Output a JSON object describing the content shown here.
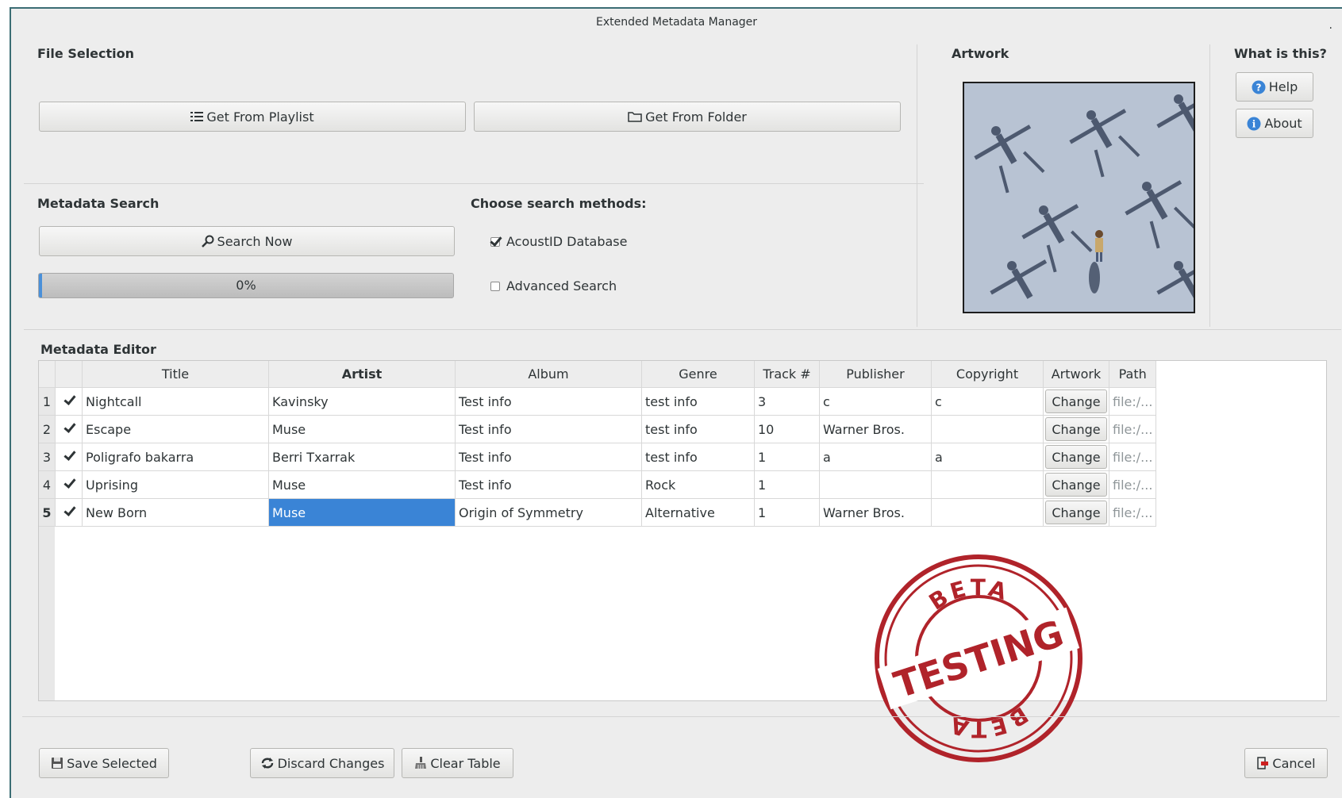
{
  "window": {
    "title": "Extended Metadata Manager"
  },
  "file_selection": {
    "label": "File Selection",
    "get_from_playlist": "Get From Playlist",
    "get_from_folder": "Get From Folder"
  },
  "artwork_panel": {
    "label": "Artwork"
  },
  "info_panel": {
    "label": "What is this?",
    "help": "Help",
    "about": "About"
  },
  "metadata_search": {
    "label": "Metadata Search",
    "search_now": "Search Now",
    "progress_text": "0%",
    "progress_value": 0,
    "methods_label": "Choose search methods:",
    "methods": [
      {
        "label": "AcoustID Database",
        "checked": true
      },
      {
        "label": "Advanced Search",
        "checked": false
      }
    ]
  },
  "editor": {
    "label": "Metadata Editor",
    "columns": [
      "Title",
      "Artist",
      "Album",
      "Genre",
      "Track #",
      "Publisher",
      "Copyright",
      "Artwork",
      "Path"
    ],
    "rows": [
      {
        "num": "1",
        "checked": true,
        "title": "Nightcall",
        "artist": "Kavinsky",
        "album": "Test info",
        "genre": "test info",
        "track": "3",
        "publisher": "c",
        "copyright": "c",
        "artwork": "Change",
        "path": "file:/..."
      },
      {
        "num": "2",
        "checked": true,
        "title": "Escape",
        "artist": "Muse",
        "album": "Test info",
        "genre": "test info",
        "track": "10",
        "publisher": "Warner Bros.",
        "copyright": "",
        "artwork": "Change",
        "path": "file:/..."
      },
      {
        "num": "3",
        "checked": true,
        "title": "Poligrafo bakarra",
        "artist": "Berri Txarrak",
        "album": "Test info",
        "genre": "test info",
        "track": "1",
        "publisher": "a",
        "copyright": "a",
        "artwork": "Change",
        "path": "file:/..."
      },
      {
        "num": "4",
        "checked": true,
        "title": "Uprising",
        "artist": "Muse",
        "album": "Test info",
        "genre": "Rock",
        "track": "1",
        "publisher": "",
        "copyright": "",
        "artwork": "Change",
        "path": "file:/..."
      },
      {
        "num": "5",
        "checked": true,
        "title": "New Born",
        "artist": "Muse",
        "album": "Origin of Symmetry",
        "genre": "Alternative",
        "track": "1",
        "publisher": "Warner Bros.",
        "copyright": "",
        "artwork": "Change",
        "path": "file:/..."
      }
    ]
  },
  "stamp": {
    "top": "BETA",
    "middle": "TESTING",
    "bottom": "BETA"
  },
  "footer": {
    "save_selected": "Save Selected",
    "discard_changes": "Discard Changes",
    "clear_table": "Clear Table",
    "cancel": "Cancel"
  },
  "icons": {
    "playlist": "list-icon",
    "folder": "folder-icon",
    "search": "magnifier-icon",
    "help": "question-circle-icon",
    "about": "info-circle-icon",
    "save": "floppy-disk-icon",
    "discard": "refresh-icon",
    "clear": "broom-icon",
    "cancel": "exit-door-icon"
  },
  "colors": {
    "accent": "#4a90d9",
    "selection": "#3a84d6",
    "stamp": "#b0232a",
    "window_border": "#3b6d74"
  }
}
